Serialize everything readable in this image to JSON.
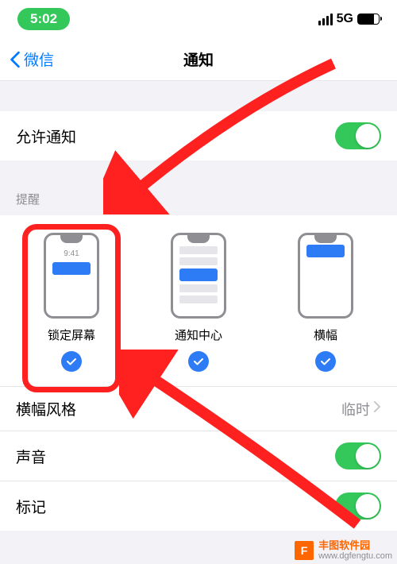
{
  "status": {
    "time": "5:02",
    "network": "5G"
  },
  "nav": {
    "back_label": "微信",
    "title": "通知"
  },
  "allow": {
    "label": "允许通知"
  },
  "alerts_section": {
    "header": "提醒"
  },
  "alert_items": {
    "lock": {
      "label": "锁定屏幕",
      "time": "9:41"
    },
    "center": {
      "label": "通知中心"
    },
    "banner": {
      "label": "横幅"
    }
  },
  "banner_style": {
    "label": "横幅风格",
    "value": "临时"
  },
  "sound": {
    "label": "声音"
  },
  "badge": {
    "label": "标记"
  },
  "watermark": {
    "title": "丰图软件园",
    "url": "www.dgfengtu.com"
  }
}
